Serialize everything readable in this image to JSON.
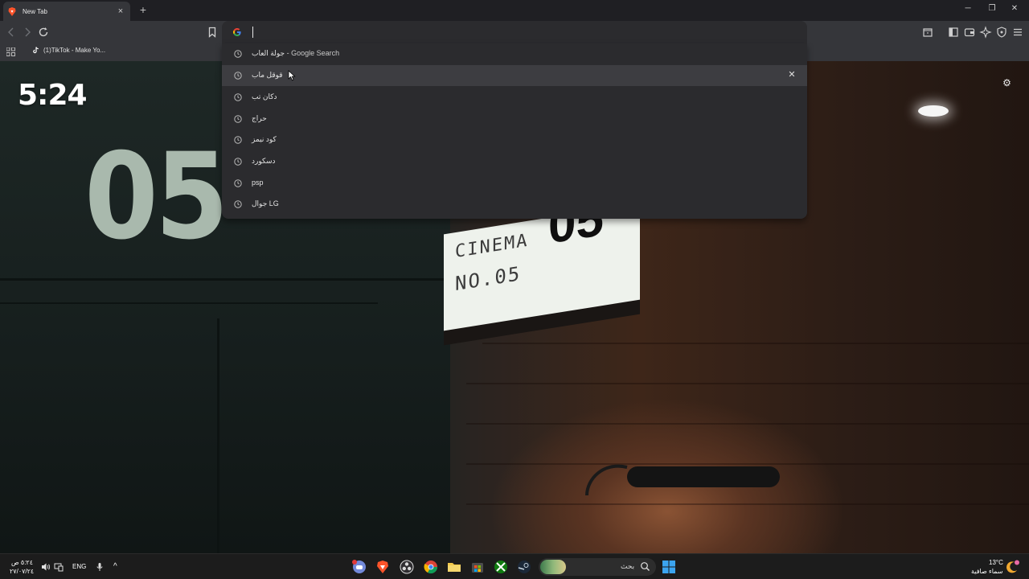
{
  "browser": {
    "tab": {
      "title": "New Tab",
      "close": "×"
    },
    "new_tab": "+",
    "window_controls": {
      "minimize": "─",
      "restore": "❐",
      "close": "✕"
    }
  },
  "bookmarks": [
    {
      "label": "(1)TikTok - Make Yo..."
    }
  ],
  "omnibox": {
    "value": ""
  },
  "suggestions": [
    {
      "text": "جولة العاب",
      "suffix": " - Google Search",
      "hover": false
    },
    {
      "text": "قوقل ماب",
      "suffix": "",
      "hover": true
    },
    {
      "text": "دكان تب",
      "suffix": "",
      "hover": false
    },
    {
      "text": "حراج",
      "suffix": "",
      "hover": false
    },
    {
      "text": "كود نيمز",
      "suffix": "",
      "hover": false
    },
    {
      "text": "دسكورد",
      "suffix": "",
      "hover": false
    },
    {
      "text": "psp",
      "suffix": "",
      "hover": false
    },
    {
      "text": "جوال LG",
      "suffix": "",
      "hover": false
    }
  ],
  "remove_suggestion": "✕",
  "new_tab_page": {
    "clock": "5:24",
    "background": {
      "number": "05",
      "sign_line1": "CINEMA",
      "sign_line2": "NO.05",
      "sign_big": "05"
    }
  },
  "taskbar": {
    "time": "٥:٢٤ ص",
    "date": "٢٧/٠٧/٢٤",
    "language": "ENG",
    "tray_chevron": "^",
    "search_placeholder": "بحث",
    "weather_temp": "13°C",
    "weather_desc": "سماء صافية"
  },
  "colors": {
    "accent_brave": "#fb542b",
    "dropdown_bg": "#2b2b2e",
    "dropdown_hover": "#3d3d41",
    "toolbar": "#35363a"
  }
}
